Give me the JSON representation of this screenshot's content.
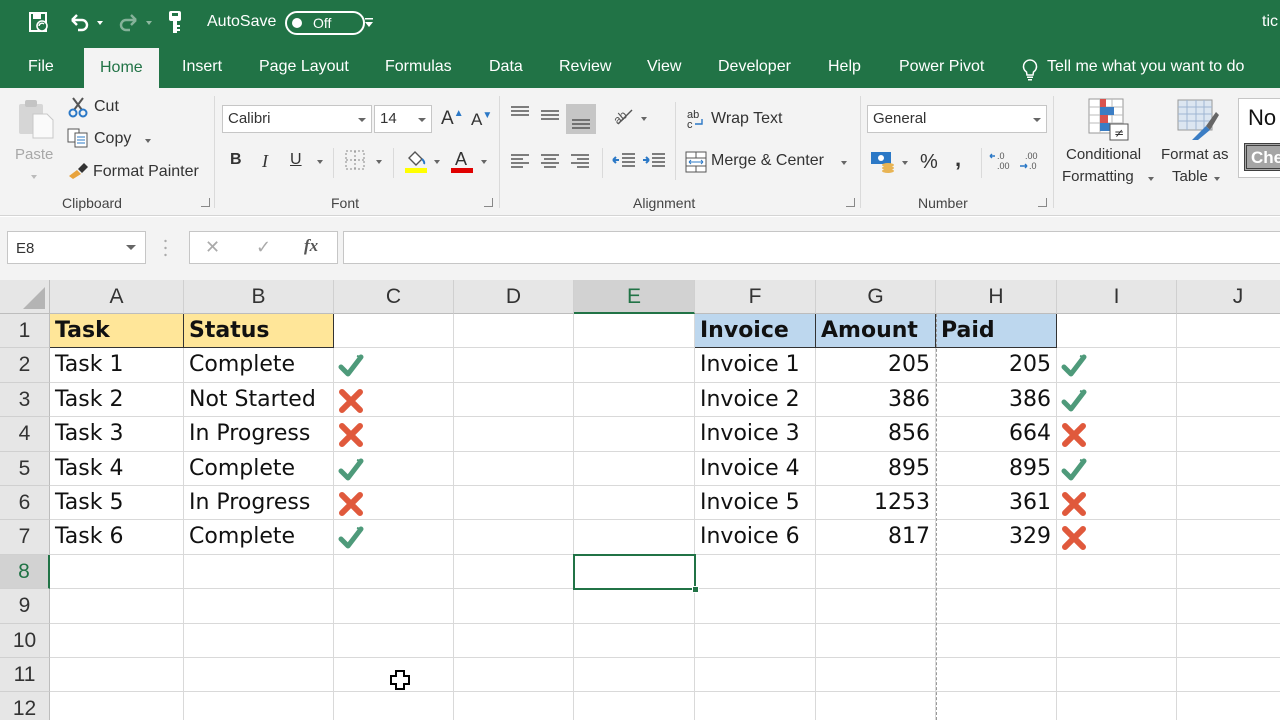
{
  "titlebar": {
    "autosave_label": "AutoSave",
    "autosave_state": "Off",
    "document_title": "tic"
  },
  "tabs": [
    {
      "label": "File"
    },
    {
      "label": "Home",
      "active": true
    },
    {
      "label": "Insert"
    },
    {
      "label": "Page Layout"
    },
    {
      "label": "Formulas"
    },
    {
      "label": "Data"
    },
    {
      "label": "Review"
    },
    {
      "label": "View"
    },
    {
      "label": "Developer"
    },
    {
      "label": "Help"
    },
    {
      "label": "Power Pivot"
    }
  ],
  "tell_me": "Tell me what you want to do",
  "ribbon": {
    "clipboard": {
      "label": "Clipboard",
      "paste": "Paste",
      "cut": "Cut",
      "copy": "Copy",
      "format_painter": "Format Painter"
    },
    "font": {
      "label": "Font",
      "font_name": "Calibri",
      "font_size": "14",
      "bold": "B",
      "italic": "I",
      "underline": "U",
      "highlight_color": "#ffff00",
      "font_color": "#e00000"
    },
    "alignment": {
      "label": "Alignment",
      "wrap_text": "Wrap Text",
      "merge_center": "Merge & Center"
    },
    "number": {
      "label": "Number",
      "format": "General",
      "percent": "%",
      "comma": ","
    },
    "styles": {
      "conditional_formatting_1": "Conditional",
      "conditional_formatting_2": "Formatting",
      "format_as_table_1": "Format as",
      "format_as_table_2": "Table",
      "style_normal": "No",
      "style_check": "Che"
    }
  },
  "formula_bar": {
    "name_box": "E8",
    "cancel": "✕",
    "enter": "✓",
    "fx": "fx",
    "formula": ""
  },
  "sheet": {
    "columns": [
      "A",
      "B",
      "C",
      "D",
      "E",
      "F",
      "G",
      "H",
      "I",
      "J"
    ],
    "selected_column": "E",
    "rows": [
      "1",
      "2",
      "3",
      "4",
      "5",
      "6",
      "7",
      "8",
      "9",
      "10",
      "11",
      "12"
    ],
    "selected_row": "8",
    "active_cell": "E8",
    "colors": {
      "check": "#4e9a7a",
      "cross": "#e0593c",
      "header_yellow": "#ffe699",
      "header_blue": "#bdd7ee",
      "accent": "#217346"
    },
    "task_table": {
      "headers": [
        "Task",
        "Status"
      ],
      "rows": [
        {
          "task": "Task 1",
          "status": "Complete",
          "icon": "check"
        },
        {
          "task": "Task 2",
          "status": "Not Started",
          "icon": "cross"
        },
        {
          "task": "Task 3",
          "status": "In Progress",
          "icon": "cross"
        },
        {
          "task": "Task 4",
          "status": "Complete",
          "icon": "check"
        },
        {
          "task": "Task 5",
          "status": "In Progress",
          "icon": "cross"
        },
        {
          "task": "Task 6",
          "status": "Complete",
          "icon": "check"
        }
      ]
    },
    "invoice_table": {
      "headers": [
        "Invoice",
        "Amount",
        "Paid"
      ],
      "rows": [
        {
          "invoice": "Invoice 1",
          "amount": "205",
          "paid": "205",
          "icon": "check"
        },
        {
          "invoice": "Invoice 2",
          "amount": "386",
          "paid": "386",
          "icon": "check"
        },
        {
          "invoice": "Invoice 3",
          "amount": "856",
          "paid": "664",
          "icon": "cross"
        },
        {
          "invoice": "Invoice 4",
          "amount": "895",
          "paid": "895",
          "icon": "check"
        },
        {
          "invoice": "Invoice 5",
          "amount": "1253",
          "paid": "361",
          "icon": "cross"
        },
        {
          "invoice": "Invoice 6",
          "amount": "817",
          "paid": "329",
          "icon": "cross"
        }
      ]
    }
  }
}
